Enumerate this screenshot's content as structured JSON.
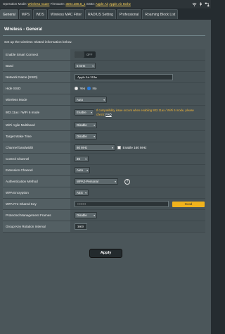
{
  "status": {
    "operation_mode_label": "Operation Mode:",
    "operation_mode_value": "Wireless router",
    "firmware_label": "Firmware:",
    "firmware_value": "3004.388.8_1",
    "ssid_label": "SSID:",
    "ssid_value_1": "Apple Air",
    "ssid_value_2": "Apple Air 5Ghz"
  },
  "tabs": [
    {
      "label": "General",
      "active": true
    },
    {
      "label": "WPS"
    },
    {
      "label": "WDS"
    },
    {
      "label": "Wireless MAC Filter"
    },
    {
      "label": "RADIUS Setting"
    },
    {
      "label": "Professional"
    },
    {
      "label": "Roaming Block List"
    }
  ],
  "section": {
    "title": "Wireless - General",
    "description": "Set up the wireless related information below."
  },
  "rows": {
    "smart_connect": {
      "label": "Enable Smart Connect",
      "state": "OFF"
    },
    "band": {
      "label": "Band",
      "value": "5 GHz"
    },
    "ssid": {
      "label": "Network Name (SSID)",
      "value": "Apple Air 5Ghz"
    },
    "hide_ssid": {
      "label": "Hide SSID",
      "opt_yes": "Yes",
      "opt_no": "No",
      "selected": "No"
    },
    "wireless_mode": {
      "label": "Wireless Mode",
      "value": "Auto"
    },
    "ax_mode": {
      "label": "802.11ax / WiFi 6 mode",
      "value": "Enable",
      "note": "If compatibility issue occurs when enabling 802.11ax / WiFi 6 mode, please check:",
      "note_link": "FAQ"
    },
    "agile_multiband": {
      "label": "WiFi Agile Multiband",
      "value": "Disable"
    },
    "target_wake_time": {
      "label": "Target Wake Time",
      "value": "Disable"
    },
    "channel_bandwidth": {
      "label": "Channel bandwidth",
      "value": "80 MHz",
      "checkbox_label": "Enable 160 MHz"
    },
    "control_channel": {
      "label": "Control Channel",
      "value": "36"
    },
    "extension_channel": {
      "label": "Extension Channel",
      "value": "Auto"
    },
    "auth_method": {
      "label": "Authentication Method",
      "value": "WPA2-Personal"
    },
    "wpa_encryption": {
      "label": "WPA Encryption",
      "value": "AES"
    },
    "wpa_key": {
      "label": "WPA Pre-Shared Key",
      "value": "••••••••",
      "strength": "Good"
    },
    "pmf": {
      "label": "Protected Management Frames",
      "value": "Disable"
    },
    "group_key": {
      "label": "Group Key Rotation Interval",
      "value": "3600"
    }
  },
  "apply_label": "Apply",
  "icons": [
    "wifi-icon",
    "usb-icon",
    "network-icon"
  ],
  "colors": {
    "accent": "#ffd65a",
    "strength": "#f0b21c",
    "note": "#f5b838"
  }
}
